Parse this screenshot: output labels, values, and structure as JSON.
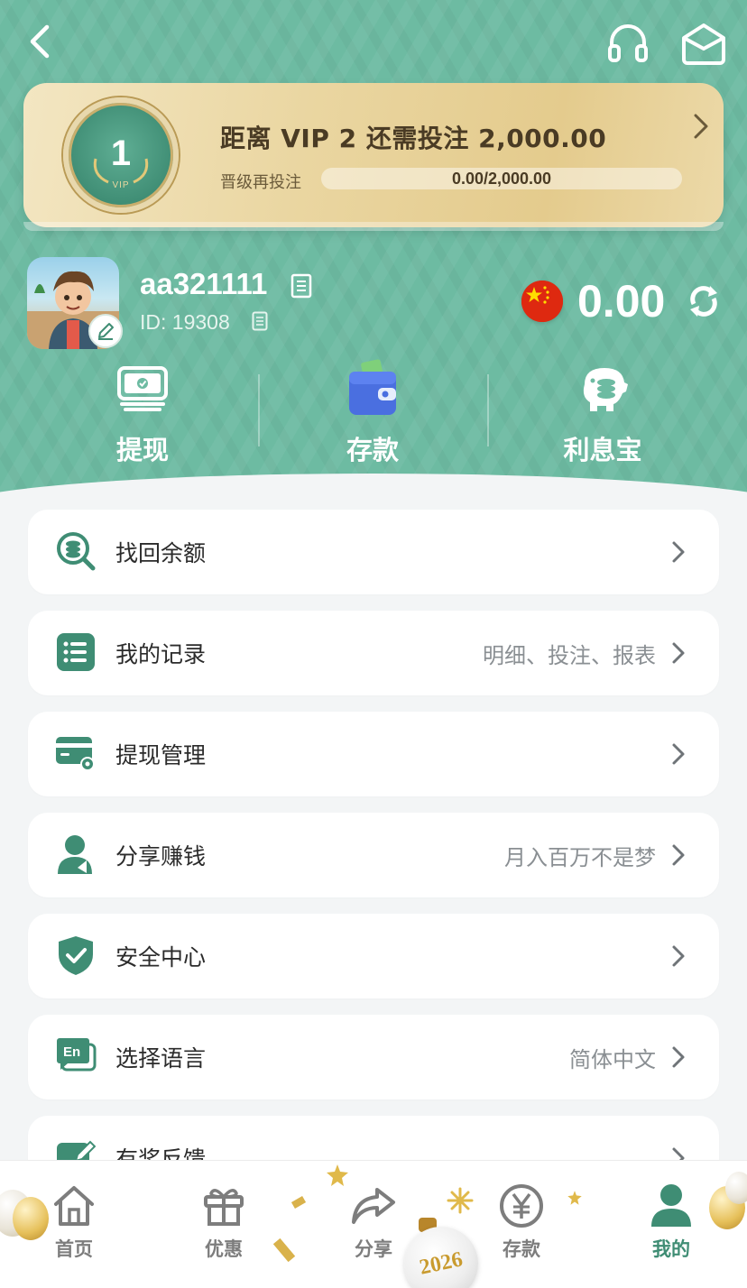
{
  "colors": {
    "brand": "#3f8d74",
    "header_bg": "#6dbba2",
    "vip_gold": "#e4cb8d",
    "text_muted": "#8a8f93"
  },
  "topbar": {
    "back_icon": "chevron-left-icon",
    "service_icon": "headset-icon",
    "mail_icon": "mail-icon"
  },
  "vip": {
    "level": "1",
    "badge_label": "VIP",
    "title": "距离 VIP 2 还需投注 2,000.00",
    "sub_label": "晋级再投注",
    "progress_text": "0.00/2,000.00",
    "progress_fraction": 0
  },
  "user": {
    "username": "aa321111",
    "id_text": "ID: 19308",
    "currency_icon": "china-flag-icon",
    "balance": "0.00"
  },
  "quick_actions": [
    {
      "label": "提现",
      "icon": "withdraw-cash-icon"
    },
    {
      "label": "存款",
      "icon": "wallet-icon"
    },
    {
      "label": "利息宝",
      "icon": "piggy-bank-icon"
    }
  ],
  "menu": [
    {
      "label": "找回余额",
      "hint": "",
      "icon": "recover-balance-icon"
    },
    {
      "label": "我的记录",
      "hint": "明细、投注、报表",
      "icon": "records-list-icon"
    },
    {
      "label": "提现管理",
      "hint": "",
      "icon": "card-settings-icon"
    },
    {
      "label": "分享赚钱",
      "hint": "月入百万不是梦",
      "icon": "share-user-icon"
    },
    {
      "label": "安全中心",
      "hint": "",
      "icon": "shield-check-icon"
    },
    {
      "label": "选择语言",
      "hint": "简体中文",
      "icon": "language-icon"
    },
    {
      "label": "有奖反馈",
      "hint": "",
      "icon": "feedback-edit-icon"
    }
  ],
  "bottom_nav": [
    {
      "label": "首页",
      "icon": "home-icon",
      "active": false
    },
    {
      "label": "优惠",
      "icon": "gift-icon",
      "active": false
    },
    {
      "label": "分享",
      "icon": "share-arrow-icon",
      "active": false
    },
    {
      "label": "存款",
      "icon": "yuan-coin-icon",
      "active": false
    },
    {
      "label": "我的",
      "icon": "user-icon",
      "active": true
    }
  ],
  "decoration": {
    "ornament_text": "2026"
  }
}
